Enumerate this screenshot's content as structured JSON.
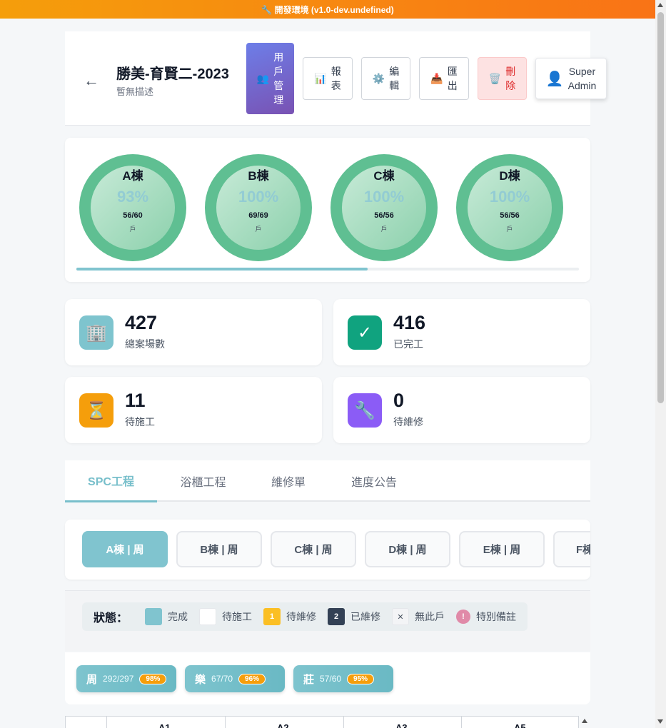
{
  "env_banner": "🔧 開發環境 (v1.0-dev.undefined)",
  "header": {
    "back": "←",
    "title": "勝美-育賢二-2023",
    "description": "暫無描述",
    "buttons": {
      "user_mgmt": {
        "icon": "👥",
        "line1": "用",
        "line2": "戶",
        "line3": "管",
        "line4": "理"
      },
      "report": {
        "icon": "📊",
        "line1": "報",
        "line2": "表"
      },
      "edit": {
        "icon": "⚙️",
        "line1": "編",
        "line2": "輯"
      },
      "export": {
        "icon": "📥",
        "line1": "匯",
        "line2": "出"
      },
      "delete": {
        "icon": "🗑️",
        "line1": "刪",
        "line2": "除"
      },
      "admin": {
        "icon": "👤",
        "line1": "Super",
        "line2": "Admin"
      }
    }
  },
  "buildings": [
    {
      "name": "A棟",
      "percent": "93%",
      "count": "56/60",
      "unit": "戶",
      "progress": 0.93
    },
    {
      "name": "B棟",
      "percent": "100%",
      "count": "69/69",
      "unit": "戶",
      "progress": 1.0
    },
    {
      "name": "C棟",
      "percent": "100%",
      "count": "56/56",
      "unit": "戶",
      "progress": 1.0
    },
    {
      "name": "D棟",
      "percent": "100%",
      "count": "56/56",
      "unit": "戶",
      "progress": 1.0
    }
  ],
  "building_scroll_fraction": 0.58,
  "stats": [
    {
      "value": "427",
      "label": "總案場數",
      "icon": "🏢",
      "color": "#7ec4ce"
    },
    {
      "value": "416",
      "label": "已完工",
      "icon": "✓",
      "color": "#10a37f"
    },
    {
      "value": "11",
      "label": "待施工",
      "icon": "⏳",
      "color": "#f59e0b"
    },
    {
      "value": "0",
      "label": "待維修",
      "icon": "🔧",
      "color": "#8b5cf6"
    }
  ],
  "tabs": [
    "SPC工程",
    "浴櫃工程",
    "維修單",
    "進度公告"
  ],
  "week_buttons": [
    "A棟 | 周",
    "B棟 | 周",
    "C棟 | 周",
    "D棟 | 周",
    "E棟 | 周",
    "F棟"
  ],
  "legend": {
    "title": "狀態：",
    "items": [
      {
        "label": "完成",
        "mark": "",
        "bg": "#80c4cf",
        "fg": "#ffffff"
      },
      {
        "label": "待施工",
        "mark": "",
        "bg": "#ffffff",
        "fg": "#000000"
      },
      {
        "label": "待維修",
        "mark": "1",
        "bg": "#fbbf24",
        "fg": "#ffffff"
      },
      {
        "label": "已維修",
        "mark": "2",
        "bg": "#334155",
        "fg": "#ffffff"
      },
      {
        "label": "無此戶",
        "mark": "✕",
        "bg": "#f3f4f6",
        "fg": "#4b5563"
      },
      {
        "label": "特別備註",
        "mark": "!",
        "bg": "#e08aa8",
        "fg": "#ffffff"
      }
    ]
  },
  "sections": [
    {
      "name": "周",
      "count": "292/297",
      "percent": "98%"
    },
    {
      "name": "樂",
      "count": "67/70",
      "percent": "96%"
    },
    {
      "name": "莊",
      "count": "57/60",
      "percent": "95%"
    }
  ],
  "table_headers": [
    "A1",
    "A2",
    "A3",
    "A5"
  ]
}
